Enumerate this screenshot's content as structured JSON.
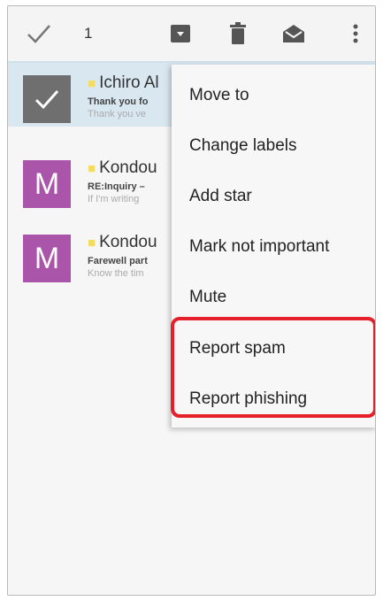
{
  "toolbar": {
    "selected_count": "1",
    "icons": [
      "check-icon",
      "archive-icon",
      "delete-icon",
      "mark-unread-icon",
      "more-vert-icon"
    ]
  },
  "messages": [
    {
      "sender": "Ichiro Al",
      "subject": "Thank you fo",
      "snippet": "Thank you ve",
      "selected": true
    },
    {
      "sender": "Kondou",
      "subject": "RE:Inquiry –",
      "snippet": "If I'm writing",
      "selected": false,
      "avatar_letter": "M"
    },
    {
      "sender": "Kondou",
      "subject": "Farewell part",
      "snippet": "Know the tim",
      "selected": false,
      "avatar_letter": "M"
    }
  ],
  "menu": {
    "items": [
      "Move to",
      "Change labels",
      "Add star",
      "Mark not important",
      "Mute",
      "Report spam",
      "Report phishing"
    ]
  },
  "colors": {
    "avatar": "#aa55aa",
    "selected_row": "#d9e7f1",
    "highlight_border": "#e5202a"
  }
}
